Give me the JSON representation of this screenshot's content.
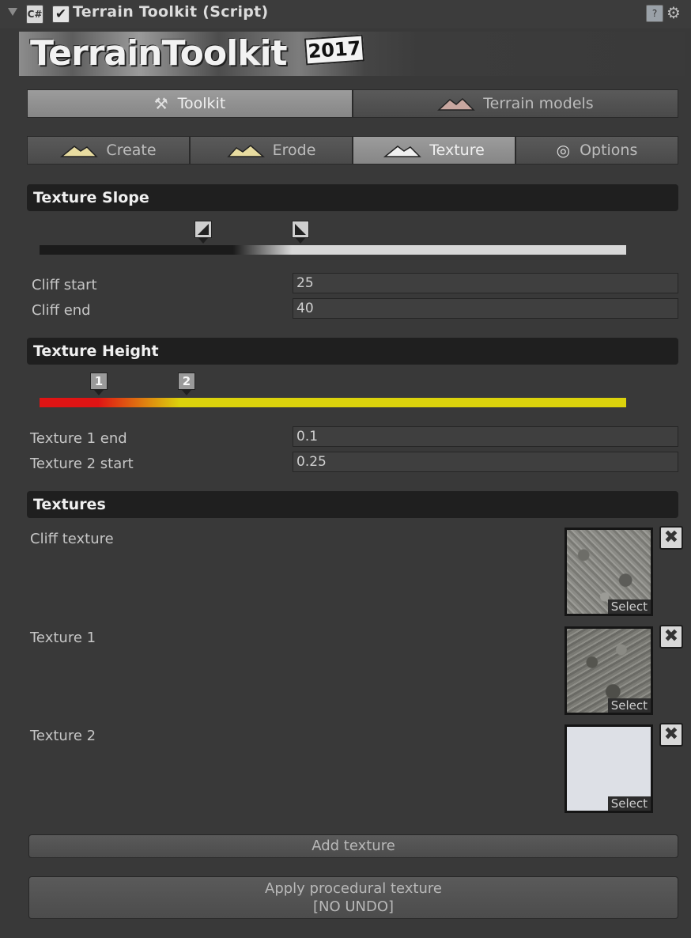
{
  "header": {
    "title": "Terrain Toolkit (Script)",
    "script_icon": "C#",
    "enabled_check": "✔",
    "help_icon": "?",
    "gear_icon": "⚙"
  },
  "banner": {
    "title": "TerrainToolkit",
    "year": "2017"
  },
  "main_tabs": [
    {
      "label": "Toolkit",
      "icon": "tools-icon",
      "active": true
    },
    {
      "label": "Terrain models",
      "icon": "mountain-icon",
      "active": false
    }
  ],
  "sub_tabs": [
    {
      "label": "Create",
      "icon": "mountain-icon",
      "active": false
    },
    {
      "label": "Erode",
      "icon": "mountain-icon",
      "active": false
    },
    {
      "label": "Texture",
      "icon": "mountain-icon",
      "active": true
    },
    {
      "label": "Options",
      "icon": "gear-icon",
      "active": false
    }
  ],
  "texture_slope": {
    "title": "Texture Slope",
    "cliff_start_label": "Cliff start",
    "cliff_start": "25",
    "cliff_end_label": "Cliff end",
    "cliff_end": "40"
  },
  "texture_height": {
    "title": "Texture Height",
    "handle1": "1",
    "handle2": "2",
    "tex1_end_label": "Texture 1 end",
    "tex1_end": "0.1",
    "tex2_start_label": "Texture 2 start",
    "tex2_start": "0.25"
  },
  "textures": {
    "title": "Textures",
    "items": [
      {
        "label": "Cliff texture",
        "select": "Select"
      },
      {
        "label": "Texture 1",
        "select": "Select"
      },
      {
        "label": "Texture 2",
        "select": "Select"
      }
    ],
    "remove": "✖"
  },
  "buttons": {
    "add_texture": "Add texture",
    "apply_line1": "Apply procedural texture",
    "apply_line2": "[NO UNDO]"
  }
}
